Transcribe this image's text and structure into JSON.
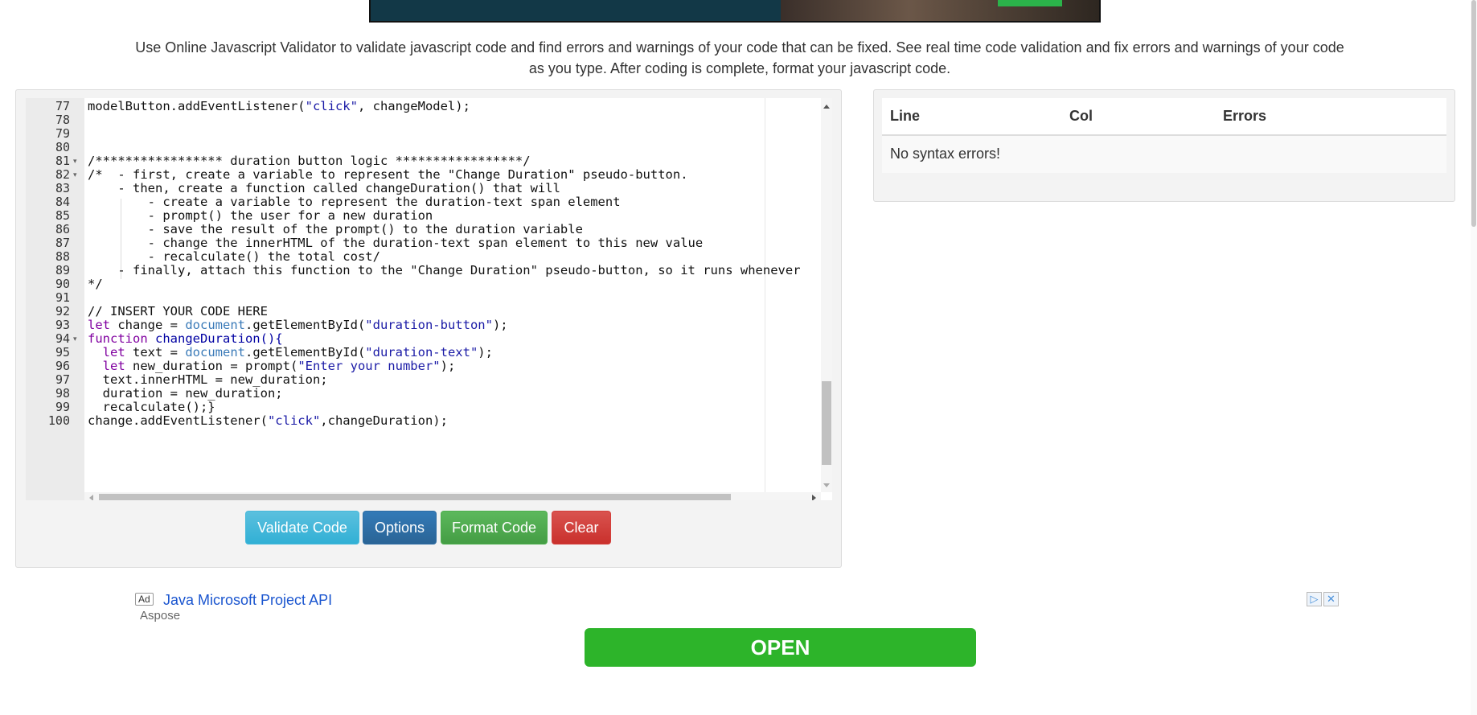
{
  "description": "Use Online Javascript Validator to validate javascript code and find errors and warnings of your code that can be fixed. See real time code validation and fix errors and warnings of your code as you type. After coding is complete, format your javascript code.",
  "editor": {
    "lines": [
      {
        "n": "77",
        "fold": false
      },
      {
        "n": "78",
        "fold": false
      },
      {
        "n": "79",
        "fold": false
      },
      {
        "n": "80",
        "fold": false
      },
      {
        "n": "81",
        "fold": true
      },
      {
        "n": "82",
        "fold": true
      },
      {
        "n": "83",
        "fold": false
      },
      {
        "n": "84",
        "fold": false
      },
      {
        "n": "85",
        "fold": false
      },
      {
        "n": "86",
        "fold": false
      },
      {
        "n": "87",
        "fold": false
      },
      {
        "n": "88",
        "fold": false
      },
      {
        "n": "89",
        "fold": false
      },
      {
        "n": "90",
        "fold": false
      },
      {
        "n": "91",
        "fold": false
      },
      {
        "n": "92",
        "fold": false
      },
      {
        "n": "93",
        "fold": false
      },
      {
        "n": "94",
        "fold": true
      },
      {
        "n": "95",
        "fold": false
      },
      {
        "n": "96",
        "fold": false
      },
      {
        "n": "97",
        "fold": false
      },
      {
        "n": "98",
        "fold": false
      },
      {
        "n": "99",
        "fold": false
      },
      {
        "n": "100",
        "fold": false
      }
    ],
    "code": {
      "l77a": "modelButton.addEventListener(",
      "l77b": "\"click\"",
      "l77c": ", changeModel);",
      "l81": "/***************** duration button logic *****************/",
      "l82": "/*  - first, create a variable to represent the \"Change Duration\" pseudo-button.",
      "l83": "    - then, create a function called changeDuration() that will",
      "l84": "        - create a variable to represent the duration-text span element",
      "l85": "        - prompt() the user for a new duration",
      "l86": "        - save the result of the prompt() to the duration variable",
      "l87": "        - change the innerHTML of the duration-text span element to this new value",
      "l88": "        - recalculate() the total cost/",
      "l89": "    - finally, attach this function to the \"Change Duration\" pseudo-button, so it runs whenever",
      "l90": "*/",
      "l92": "// INSERT YOUR CODE HERE",
      "l93a": "let",
      "l93b": " change = ",
      "l93c": "document",
      "l93d": ".getElementById(",
      "l93e": "\"duration-button\"",
      "l93f": ");",
      "l94a": "function",
      "l94b": " changeDuration(){",
      "l95a": "  let",
      "l95b": " text = ",
      "l95c": "document",
      "l95d": ".getElementById(",
      "l95e": "\"duration-text\"",
      "l95f": ");",
      "l96a": "  let",
      "l96b": " new_duration = prompt(",
      "l96c": "\"Enter your number\"",
      "l96d": ");",
      "l97": "  text.innerHTML = new_duration;",
      "l98": "  duration = new_duration;",
      "l99": "  recalculate();}",
      "l100a": "change.addEventListener(",
      "l100b": "\"click\"",
      "l100c": ",changeDuration);"
    }
  },
  "buttons": {
    "validate": "Validate Code",
    "options": "Options",
    "format": "Format Code",
    "clear": "Clear"
  },
  "results": {
    "col_line": "Line",
    "col_col": "Col",
    "col_errors": "Errors",
    "message": "No syntax errors!"
  },
  "ad": {
    "badge": "Ad",
    "title": "Java Microsoft Project API",
    "source": "Aspose",
    "cta": "OPEN"
  }
}
